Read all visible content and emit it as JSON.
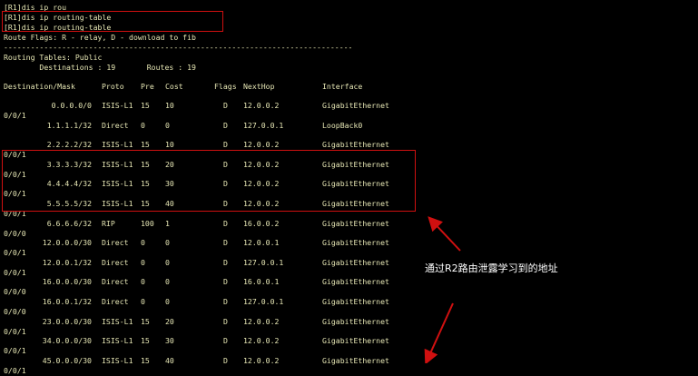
{
  "terminal": {
    "header_lines": [
      "[R1]dis ip rou",
      "[R1]dis ip routing-table",
      "[R1]dis ip routing-table",
      "Route Flags: R - relay, D - download to fib",
      "------------------------------------------------------------------------------",
      "Routing Tables: Public",
      "        Destinations : 19       Routes : 19"
    ],
    "columns": [
      "Destination/Mask",
      "Proto",
      "Pre",
      "Cost",
      "Flags",
      "NextHop",
      "Interface"
    ],
    "rows": [
      {
        "dest": "0.0.0.0/0",
        "proto": "ISIS-L1",
        "pre": "15",
        "cost": "10",
        "flags": "D",
        "nexthop": "12.0.0.2",
        "iface": "GigabitEthernet",
        "cont": "0/0/1"
      },
      {
        "dest": "1.1.1.1/32",
        "proto": "Direct",
        "pre": "0",
        "cost": "0",
        "flags": "D",
        "nexthop": "127.0.0.1",
        "iface": "LoopBack0",
        "cont": ""
      },
      {
        "dest": "2.2.2.2/32",
        "proto": "ISIS-L1",
        "pre": "15",
        "cost": "10",
        "flags": "D",
        "nexthop": "12.0.0.2",
        "iface": "GigabitEthernet",
        "cont": "0/0/1"
      },
      {
        "dest": "3.3.3.3/32",
        "proto": "ISIS-L1",
        "pre": "15",
        "cost": "20",
        "flags": "D",
        "nexthop": "12.0.0.2",
        "iface": "GigabitEthernet",
        "cont": "0/0/1"
      },
      {
        "dest": "4.4.4.4/32",
        "proto": "ISIS-L1",
        "pre": "15",
        "cost": "30",
        "flags": "D",
        "nexthop": "12.0.0.2",
        "iface": "GigabitEthernet",
        "cont": "0/0/1"
      },
      {
        "dest": "5.5.5.5/32",
        "proto": "ISIS-L1",
        "pre": "15",
        "cost": "40",
        "flags": "D",
        "nexthop": "12.0.0.2",
        "iface": "GigabitEthernet",
        "cont": "0/0/1"
      },
      {
        "dest": "6.6.6.6/32",
        "proto": "RIP",
        "pre": "100",
        "cost": "1",
        "flags": "D",
        "nexthop": "16.0.0.2",
        "iface": "GigabitEthernet",
        "cont": "0/0/0"
      },
      {
        "dest": "12.0.0.0/30",
        "proto": "Direct",
        "pre": "0",
        "cost": "0",
        "flags": "D",
        "nexthop": "12.0.0.1",
        "iface": "GigabitEthernet",
        "cont": "0/0/1"
      },
      {
        "dest": "12.0.0.1/32",
        "proto": "Direct",
        "pre": "0",
        "cost": "0",
        "flags": "D",
        "nexthop": "127.0.0.1",
        "iface": "GigabitEthernet",
        "cont": "0/0/1"
      },
      {
        "dest": "16.0.0.0/30",
        "proto": "Direct",
        "pre": "0",
        "cost": "0",
        "flags": "D",
        "nexthop": "16.0.0.1",
        "iface": "GigabitEthernet",
        "cont": "0/0/0"
      },
      {
        "dest": "16.0.0.1/32",
        "proto": "Direct",
        "pre": "0",
        "cost": "0",
        "flags": "D",
        "nexthop": "127.0.0.1",
        "iface": "GigabitEthernet",
        "cont": "0/0/0"
      },
      {
        "dest": "23.0.0.0/30",
        "proto": "ISIS-L1",
        "pre": "15",
        "cost": "20",
        "flags": "D",
        "nexthop": "12.0.0.2",
        "iface": "GigabitEthernet",
        "cont": "0/0/1"
      },
      {
        "dest": "34.0.0.0/30",
        "proto": "ISIS-L1",
        "pre": "15",
        "cost": "30",
        "flags": "D",
        "nexthop": "12.0.0.2",
        "iface": "GigabitEthernet",
        "cont": "0/0/1"
      },
      {
        "dest": "45.0.0.0/30",
        "proto": "ISIS-L1",
        "pre": "15",
        "cost": "40",
        "flags": "D",
        "nexthop": "12.0.0.2",
        "iface": "GigabitEthernet",
        "cont": "0/0/1"
      }
    ]
  },
  "annotation": {
    "text": "通过R2路由泄露学习到的地址"
  },
  "colors": {
    "background": "#000000",
    "text": "#e6e6b4",
    "highlight": "#d01010"
  }
}
